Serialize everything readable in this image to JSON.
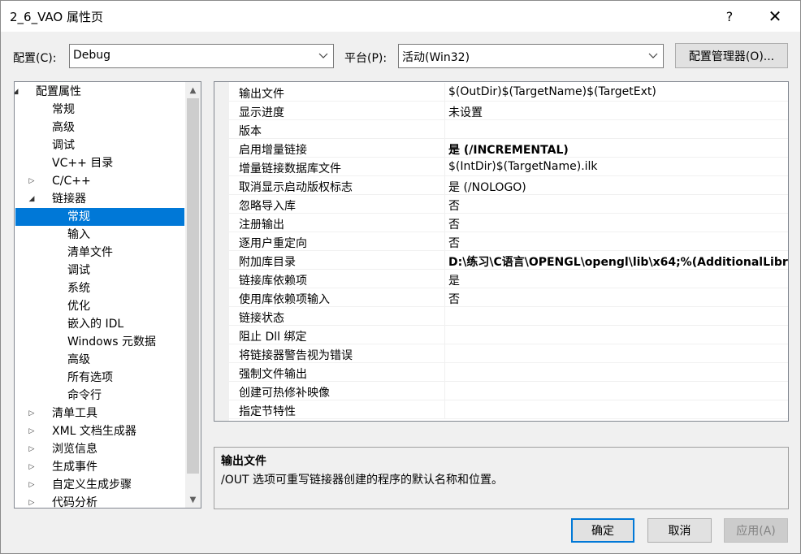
{
  "window": {
    "title": "2_6_VAO 属性页",
    "help": "?",
    "close": "✕"
  },
  "config": {
    "label": "配置(C):",
    "value": "Debug"
  },
  "platform": {
    "label": "平台(P):",
    "value": "活动(Win32)"
  },
  "config_manager_label": "配置管理器(O)...",
  "tree": [
    {
      "label": "配置属性",
      "expander": "◢",
      "level": 0
    },
    {
      "label": "常规",
      "level": 1
    },
    {
      "label": "高级",
      "level": 1
    },
    {
      "label": "调试",
      "level": 1
    },
    {
      "label": "VC++ 目录",
      "level": 1
    },
    {
      "label": "C/C++",
      "expander": "▷",
      "level": 1
    },
    {
      "label": "链接器",
      "expander": "◢",
      "level": 1
    },
    {
      "label": "常规",
      "level": 2,
      "selected": true
    },
    {
      "label": "输入",
      "level": 2
    },
    {
      "label": "清单文件",
      "level": 2
    },
    {
      "label": "调试",
      "level": 2
    },
    {
      "label": "系统",
      "level": 2
    },
    {
      "label": "优化",
      "level": 2
    },
    {
      "label": "嵌入的 IDL",
      "level": 2
    },
    {
      "label": "Windows 元数据",
      "level": 2
    },
    {
      "label": "高级",
      "level": 2
    },
    {
      "label": "所有选项",
      "level": 2
    },
    {
      "label": "命令行",
      "level": 2
    },
    {
      "label": "清单工具",
      "expander": "▷",
      "level": 1
    },
    {
      "label": "XML 文档生成器",
      "expander": "▷",
      "level": 1
    },
    {
      "label": "浏览信息",
      "expander": "▷",
      "level": 1
    },
    {
      "label": "生成事件",
      "expander": "▷",
      "level": 1
    },
    {
      "label": "自定义生成步骤",
      "expander": "▷",
      "level": 1
    },
    {
      "label": "代码分析",
      "expander": "▷",
      "level": 1
    }
  ],
  "properties": [
    {
      "name": "输出文件",
      "value": "$(OutDir)$(TargetName)$(TargetExt)"
    },
    {
      "name": "显示进度",
      "value": "未设置"
    },
    {
      "name": "版本",
      "value": ""
    },
    {
      "name": "启用增量链接",
      "value": "是 (/INCREMENTAL)",
      "bold": true
    },
    {
      "name": "增量链接数据库文件",
      "value": "$(IntDir)$(TargetName).ilk"
    },
    {
      "name": "取消显示启动版权标志",
      "value": "是 (/NOLOGO)"
    },
    {
      "name": "忽略导入库",
      "value": "否"
    },
    {
      "name": "注册输出",
      "value": "否"
    },
    {
      "name": "逐用户重定向",
      "value": "否"
    },
    {
      "name": "附加库目录",
      "value": "D:\\练习\\C语言\\OPENGL\\opengl\\lib\\x64;%(AdditionalLibr",
      "bold": true
    },
    {
      "name": "链接库依赖项",
      "value": "是"
    },
    {
      "name": "使用库依赖项输入",
      "value": "否"
    },
    {
      "name": "链接状态",
      "value": ""
    },
    {
      "name": "阻止 Dll 绑定",
      "value": ""
    },
    {
      "name": "将链接器警告视为错误",
      "value": ""
    },
    {
      "name": "强制文件输出",
      "value": ""
    },
    {
      "name": "创建可热修补映像",
      "value": ""
    },
    {
      "name": "指定节特性",
      "value": ""
    }
  ],
  "description": {
    "title": "输出文件",
    "text": "/OUT 选项可重写链接器创建的程序的默认名称和位置。"
  },
  "buttons": {
    "ok": "确定",
    "cancel": "取消",
    "apply": "应用(A)"
  }
}
